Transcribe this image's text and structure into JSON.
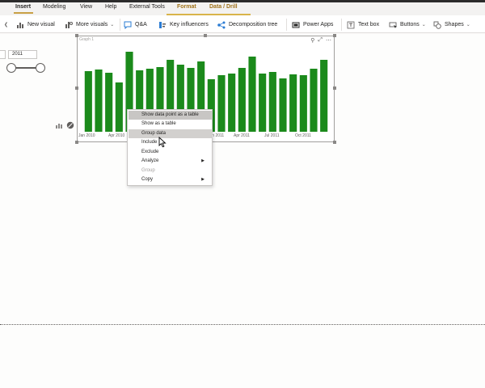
{
  "menubar": {
    "tabs": [
      "Insert",
      "Modeling",
      "View",
      "Help",
      "External Tools",
      "Format",
      "Data / Drill"
    ],
    "active_tab": "Insert"
  },
  "ribbon": {
    "new_visual": "New visual",
    "more_visuals": "More visuals",
    "qa": "Q&A",
    "key_influencers": "Key influencers",
    "decomposition_tree": "Decomposition tree",
    "power_apps": "Power Apps",
    "text_box": "Text box",
    "buttons": "Buttons",
    "shapes": "Shapes"
  },
  "slicer": {
    "year_value": "2011"
  },
  "visual": {
    "title": "Graph 1",
    "bar_color": "#1b8a1b",
    "x_ticks": [
      "Jan 2010",
      "Apr 2010",
      "Jan 2011",
      "Apr 2011",
      "Jul 2011",
      "Oct 2011"
    ]
  },
  "chart_data": {
    "type": "bar",
    "categories": [
      "Jan 2010",
      "Feb 2010",
      "Mar 2010",
      "Apr 2010",
      "May 2010",
      "Jun 2010",
      "Jul 2010",
      "Aug 2010",
      "Sep 2010",
      "Oct 2010",
      "Nov 2010",
      "Dec 2010",
      "Jan 2011",
      "Feb 2011",
      "Mar 2011",
      "Apr 2011",
      "May 2011",
      "Jun 2011",
      "Jul 2011",
      "Aug 2011",
      "Sep 2011",
      "Oct 2011",
      "Nov 2011",
      "Dec 2011"
    ],
    "values": [
      75,
      77,
      73,
      61,
      99,
      76,
      78,
      80,
      89,
      83,
      79,
      87,
      65,
      70,
      72,
      79,
      93,
      72,
      74,
      66,
      71,
      70,
      78,
      89
    ],
    "ylim": [
      0,
      100
    ],
    "grid": false
  },
  "context_menu": {
    "items": [
      {
        "label": "Show data point as a table",
        "state": "highlighted",
        "submenu": false
      },
      {
        "label": "Show as a table",
        "state": "normal",
        "submenu": false
      },
      {
        "label": "Group data",
        "state": "hover",
        "submenu": false
      },
      {
        "label": "Include",
        "state": "normal",
        "submenu": false
      },
      {
        "label": "Exclude",
        "state": "normal",
        "submenu": false
      },
      {
        "label": "Analyze",
        "state": "normal",
        "submenu": true
      },
      {
        "label": "Group",
        "state": "disabled",
        "submenu": false
      },
      {
        "label": "Copy",
        "state": "normal",
        "submenu": true
      }
    ]
  }
}
